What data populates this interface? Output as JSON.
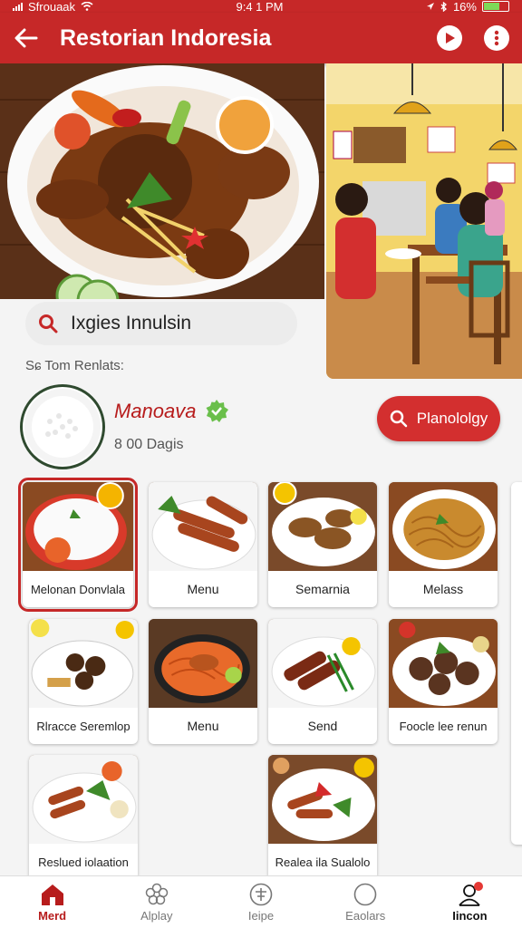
{
  "status_bar": {
    "carrier": "Sfrouaak",
    "time": "9:4 1 PM",
    "battery": "16%",
    "battery_level": 0.6
  },
  "app_bar": {
    "title": "Restorian Indoresia",
    "back_icon": "arrow-left-icon",
    "actions": [
      "play-icon",
      "more-vert-icon"
    ]
  },
  "search": {
    "value": "Ixgies Innulsin",
    "icon": "search-icon"
  },
  "hint": "Sɕ Tom Renlats:",
  "restaurant": {
    "name": "Manoava",
    "subtitle": "8 00 Dagis",
    "verified_icon": "verified-badge-icon",
    "cta_label": "Planololgy",
    "cta_icon": "search-icon"
  },
  "menu_items": [
    {
      "label": "Melonan Donvlala",
      "dish": "rice",
      "selected": true
    },
    {
      "label": "Menu",
      "dish": "satay"
    },
    {
      "label": "Semarnia",
      "dish": "fried-chicken"
    },
    {
      "label": "Melass",
      "dish": "noodles"
    },
    {
      "label": "Rlracce Seremlop",
      "dish": "rendang-plate"
    },
    {
      "label": "Menu",
      "dish": "fried-noodles"
    },
    {
      "label": "Send",
      "dish": "grilled"
    },
    {
      "label": "Foocle lee renun",
      "dish": "meatballs"
    },
    {
      "label": "Reslued iolaation",
      "dish": "mixed"
    },
    {
      "label": "Realea ila Sualolo",
      "dish": "platter"
    }
  ],
  "bottom_nav": [
    {
      "label": "Merd",
      "icon": "home-icon",
      "active": true
    },
    {
      "label": "Alplay",
      "icon": "flower-icon"
    },
    {
      "label": "Ieipe",
      "icon": "plus-circle-icon"
    },
    {
      "label": "Eaolars",
      "icon": "circle-icon"
    },
    {
      "label": "Iincon",
      "icon": "user-icon",
      "badge": true
    }
  ],
  "colors": {
    "primary": "#c62828",
    "accent": "#d32f2f",
    "verified": "#6abf4b"
  }
}
